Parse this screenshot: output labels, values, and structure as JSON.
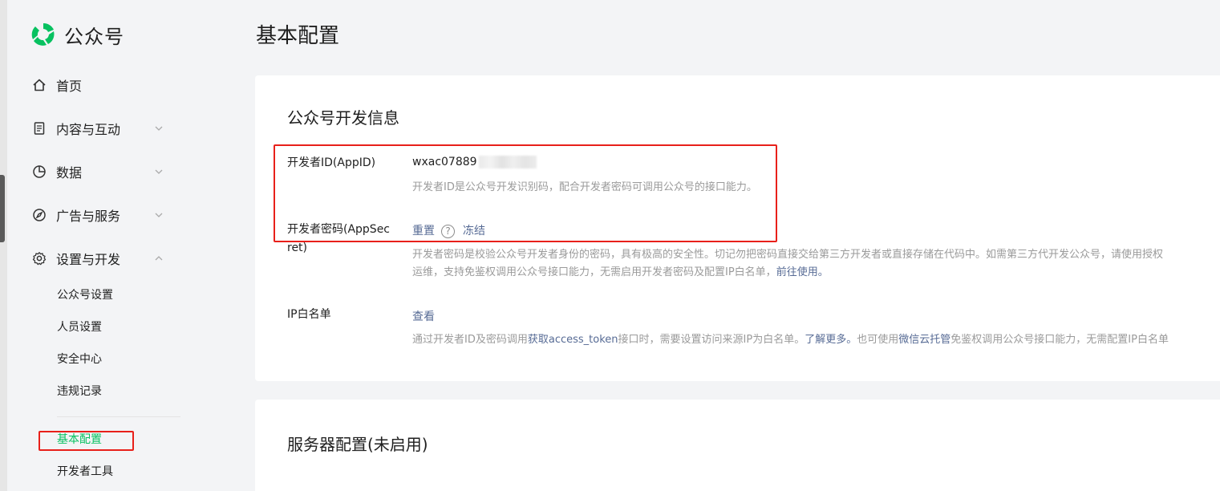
{
  "app": {
    "name": "公众号"
  },
  "sidebar": {
    "items": [
      {
        "label": "首页",
        "icon": "home-icon"
      },
      {
        "label": "内容与互动",
        "icon": "document-icon"
      },
      {
        "label": "数据",
        "icon": "pie-chart-icon"
      },
      {
        "label": "广告与服务",
        "icon": "compass-icon"
      },
      {
        "label": "设置与开发",
        "icon": "gear-icon"
      }
    ],
    "sub_items": [
      "公众号设置",
      "人员设置",
      "安全中心",
      "违规记录",
      "基本配置",
      "开发者工具"
    ],
    "active_sub": "基本配置"
  },
  "page": {
    "title": "基本配置"
  },
  "dev_info": {
    "title": "公众号开发信息",
    "app_id": {
      "label": "开发者ID(AppID)",
      "value": "wxac07889",
      "desc": "开发者ID是公众号开发识别码，配合开发者密码可调用公众号的接口能力。"
    },
    "app_secret": {
      "label_line1": "开发者密码(AppSec",
      "label_line2": "ret)",
      "reset": "重置",
      "help": "?",
      "freeze": "冻结",
      "desc_line1": "开发者密码是校验公众号开发者身份的密码，具有极高的安全性。切记勿把密码直接交给第三方开发者或直接存储在代码中。如需第三方代开发公众号，请使用授权",
      "desc_line2": "运维，支持免鉴权调用公众号接口能力，无需启用开发者密码及配置IP白名单，",
      "desc_line2_link": "前往使用。"
    },
    "ip_whitelist": {
      "label": "IP白名单",
      "view": "查看",
      "desc_a": "通过开发者ID及密码调用",
      "desc_link1": "获取access_token",
      "desc_b": "接口时，需要设置访问来源IP为白名单。",
      "desc_link2": "了解更多。",
      "desc_c": "也可使用",
      "desc_link3": "微信云托管",
      "desc_d": "免鉴权调用公众号接口能力，无需配置IP白名单"
    }
  },
  "server_config": {
    "title": "服务器配置(未启用)"
  },
  "colors": {
    "accent": "#07c160",
    "link": "#576b95",
    "highlight": "#e8201a"
  }
}
